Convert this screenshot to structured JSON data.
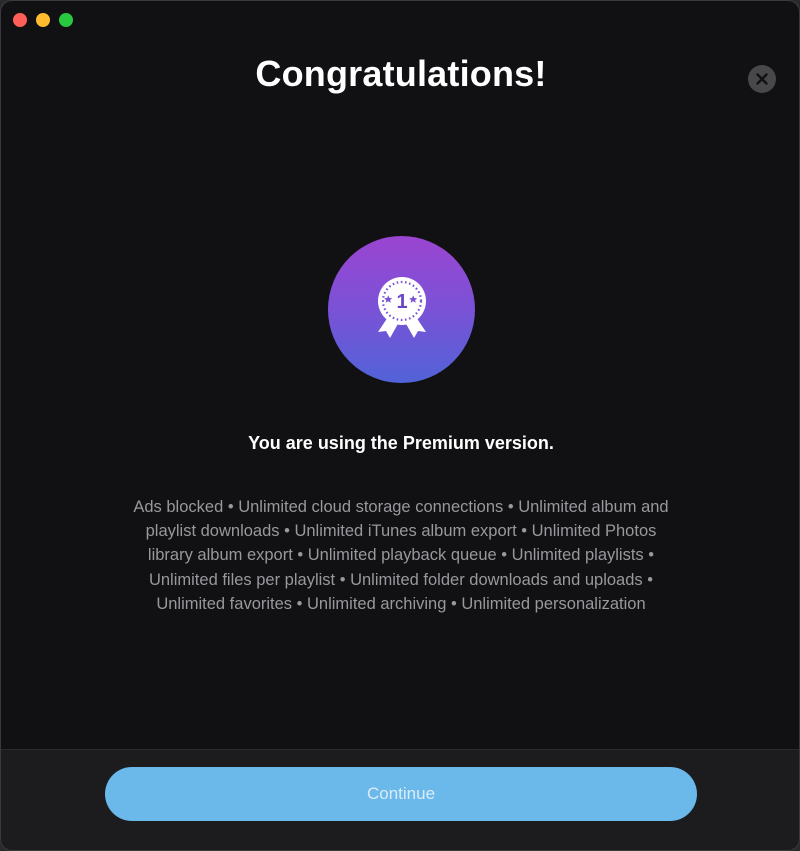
{
  "window": {
    "title": "Congratulations!"
  },
  "badge": {
    "rank": "1",
    "icon": "award-ribbon-icon",
    "gradient": [
      "#9b45d1",
      "#5163d8"
    ]
  },
  "message": {
    "subtitle": "You are using the Premium version.",
    "features_line_1": "Ads blocked • Unlimited cloud storage connections • Unlimited album and",
    "features_line_2": "playlist downloads • Unlimited iTunes album export • Unlimited Photos",
    "features_line_3": "library album export • Unlimited playback queue • Unlimited playlists •",
    "features_line_4": "Unlimited files per playlist • Unlimited folder downloads and uploads •",
    "features_line_5": "Unlimited favorites • Unlimited archiving • Unlimited personalization"
  },
  "footer": {
    "continue_label": "Continue"
  },
  "colors": {
    "background": "#111113",
    "button": "#6bb8ea",
    "text_muted": "#98989d"
  }
}
